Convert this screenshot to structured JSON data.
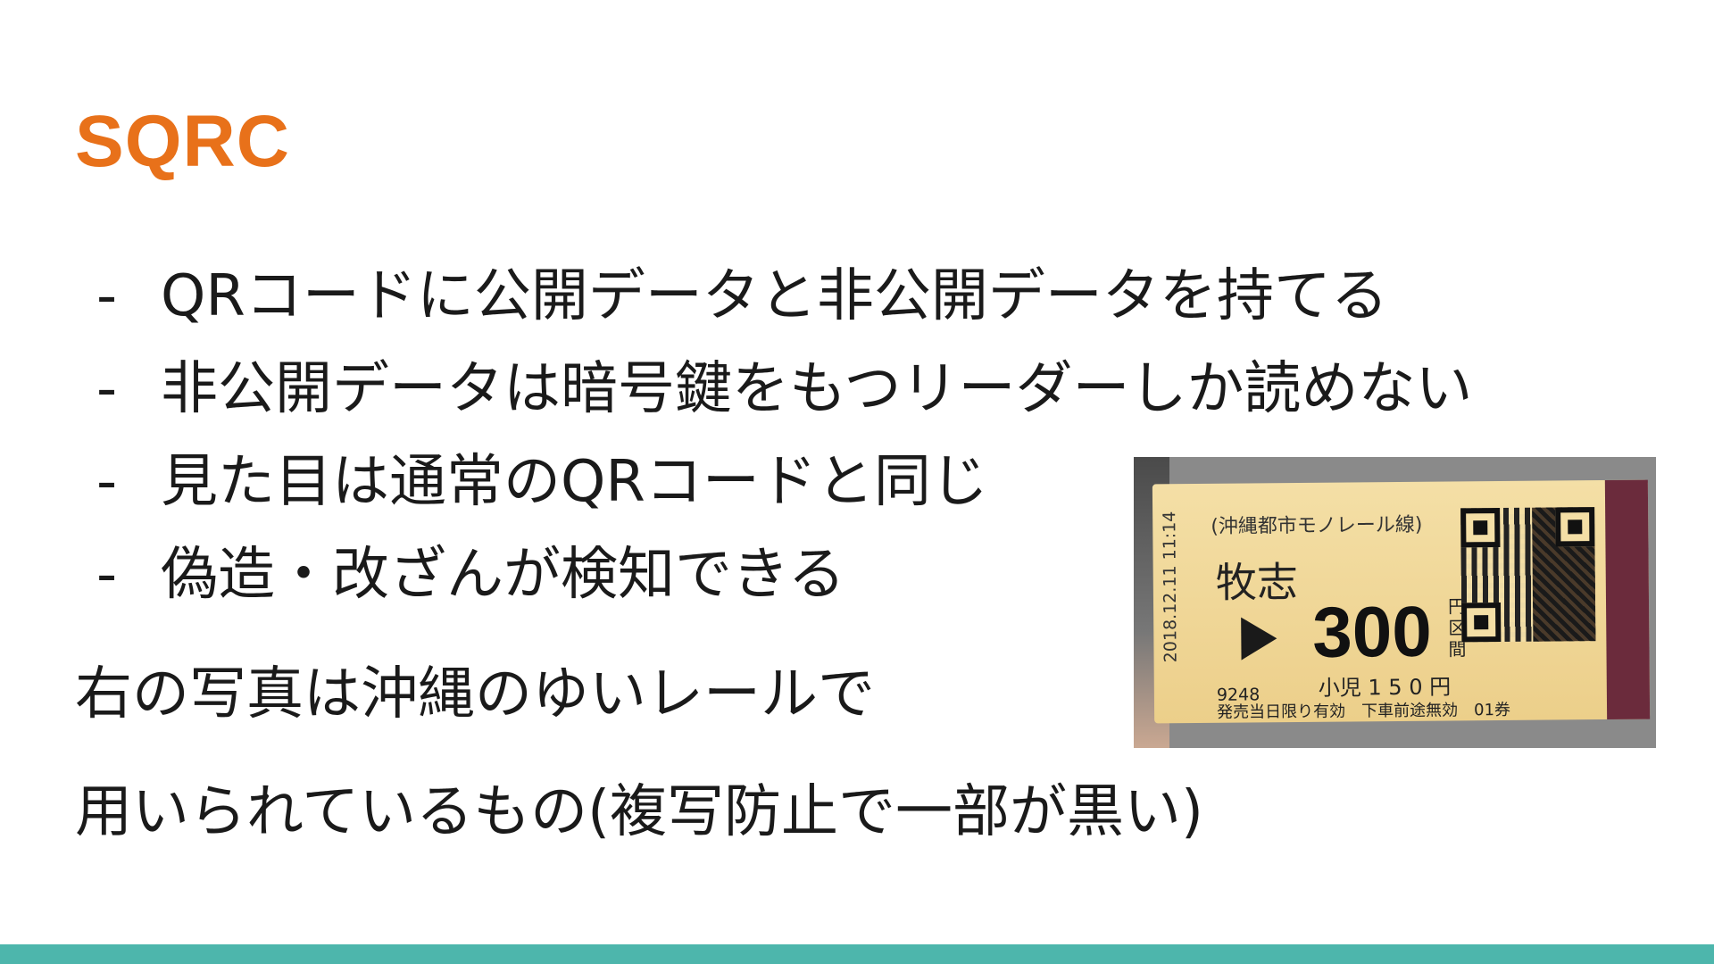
{
  "theme": {
    "title_color": "#E8711A",
    "footer_color": "#4DB6AC"
  },
  "slide": {
    "title": "SQRC",
    "bullets": [
      "QRコードに公開データと非公開データを持てる",
      "非公開データは暗号鍵をもつリーダーしか読めない",
      "見た目は通常のQRコードと同じ",
      "偽造・改ざんが検知できる"
    ],
    "bullet_marker": "-",
    "caption": {
      "line1": "右の写真は沖縄のゆいレールで",
      "line2": "用いられているもの(複写防止で一部が黒い)"
    }
  },
  "photo": {
    "ticket": {
      "line_name": "(沖縄都市モノレール線)",
      "date": "2018.12.11 11:14",
      "station": "牧志",
      "fare": "300",
      "fare_unit": "円区間",
      "child_fare": "小児 1 5 0 円",
      "number": "9248",
      "footer": "発売当日限り有効　下車前途無効　01券"
    }
  }
}
